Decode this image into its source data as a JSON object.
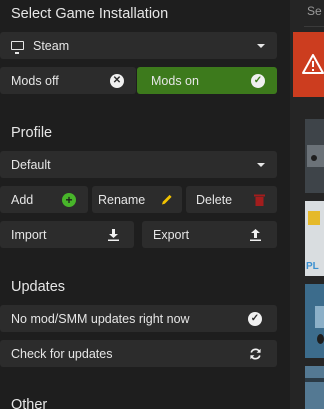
{
  "install": {
    "heading": "Select Game Installation",
    "selected": "Steam"
  },
  "mods_toggle": {
    "off_label": "Mods off",
    "on_label": "Mods on",
    "on_color": "#3d7a1c"
  },
  "profile": {
    "heading": "Profile",
    "selected": "Default",
    "add_label": "Add",
    "rename_label": "Rename",
    "delete_label": "Delete",
    "import_label": "Import",
    "export_label": "Export"
  },
  "updates": {
    "heading": "Updates",
    "status_label": "No mod/SMM updates right now",
    "check_label": "Check for updates"
  },
  "other": {
    "heading": "Other"
  },
  "right_panel": {
    "search_placeholder": "Se"
  }
}
